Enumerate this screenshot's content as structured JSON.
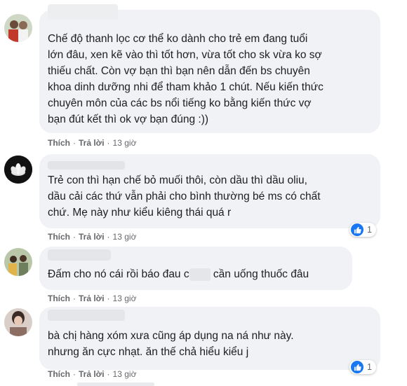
{
  "comments": [
    {
      "text": "Chế độ thanh lọc cơ thể ko dành cho trẻ em đang tuổi\nlớn đâu, xen kẽ vào thì tốt hơn, vừa tốt cho sk vừa ko sợ\nthiếu chất. Còn vợ bạn thì bạn nên dẫn đến bs chuyên\nkhoa dinh dưỡng nhi để tham khảo 1 chút. Nếu kiến thức\nchuyên môn của các bs nổi tiếng ko bằng kiến thức vợ\nbạn đút kết thì ok vợ bạn đúng :))",
      "like": "Thích",
      "reply": "Trả lời",
      "time": "13 giờ"
    },
    {
      "text": "Trẻ con thì hạn chế bỏ muối thôi, còn dầu thì dầu oliu,\ndầu cải các thứ vẫn phải cho bình thường bé ms có chất\nchứ. Mẹ này như kiểu kiêng thái quá r",
      "like": "Thích",
      "reply": "Trả lời",
      "time": "13 giờ",
      "reaction_count": "1"
    },
    {
      "text_before": "Đấm cho nó cái rồi báo đau c",
      "text_after": " cần uống thuốc đâu",
      "like": "Thích",
      "reply": "Trả lời",
      "time": "13 giờ"
    },
    {
      "text": "bà chị hàng xóm xưa cũng áp dụng na ná như này.\nnhưng ăn cực nhạt. ăn thế chả hiểu kiểu j",
      "like": "Thích",
      "reply": "Trả lời",
      "time": "13 giờ",
      "reaction_count": "1"
    }
  ],
  "colors": {
    "bubble": "#f0f2f5",
    "meta": "#65676b",
    "like_blue": "#1877f2"
  }
}
